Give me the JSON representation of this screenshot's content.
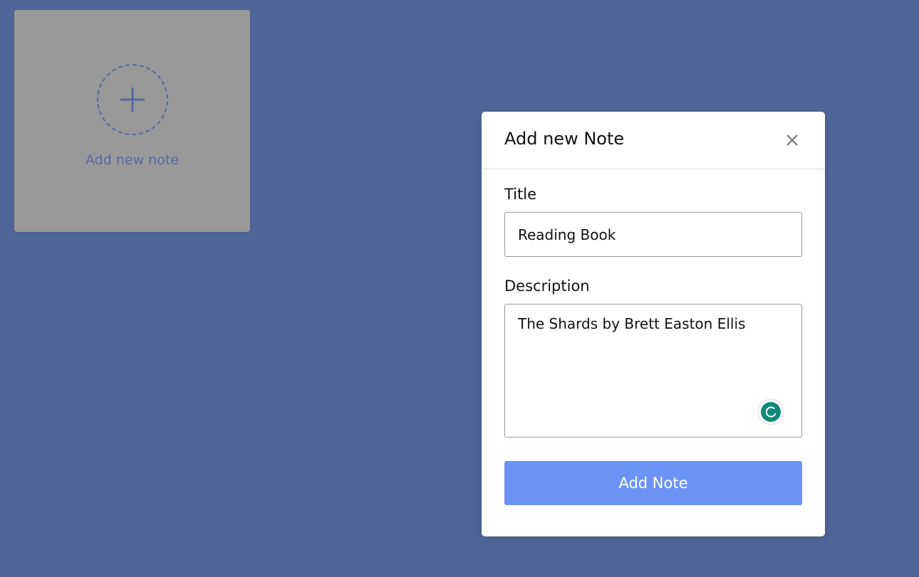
{
  "add_card": {
    "label": "Add new note",
    "icon": "plus-icon"
  },
  "modal": {
    "title": "Add new Note",
    "close_icon": "close-icon",
    "title_field": {
      "label": "Title",
      "value": "Reading Book"
    },
    "description_field": {
      "label": "Description",
      "value": "The Shards by Brett Easton Ellis"
    },
    "submit_label": "Add Note",
    "assistant_icon": "grammarly-icon"
  },
  "colors": {
    "background": "#506699",
    "card": "#999999",
    "accent": "#5668a3",
    "button": "#6b93f6",
    "assistant": "#0e8a78"
  }
}
